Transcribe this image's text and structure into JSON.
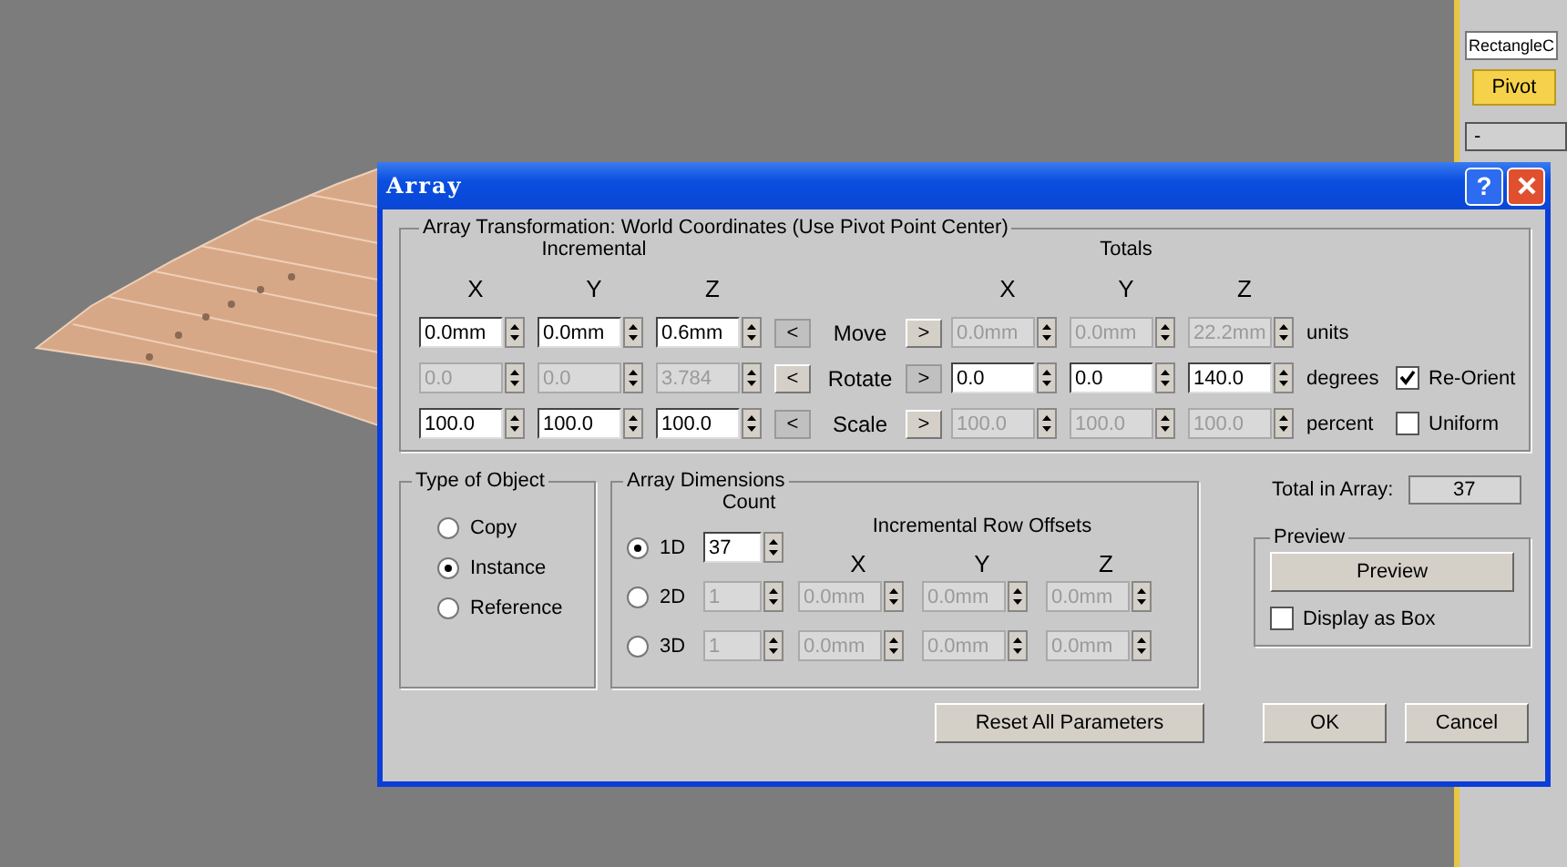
{
  "side_panel": {
    "name_field": "RectangleC",
    "pivot_button": "Pivot",
    "rollout_label": "-"
  },
  "dialog": {
    "title": "Array",
    "help_glyph": "?"
  },
  "transform": {
    "title": "Array Transformation: World Coordinates (Use Pivot Point Center)",
    "incremental_label": "Incremental",
    "totals_label": "Totals",
    "axes_incremental": [
      "X",
      "Y",
      "Z"
    ],
    "axes_totals": [
      "X",
      "Y",
      "Z"
    ],
    "rows": [
      {
        "label": "Move",
        "left_arrow": "<",
        "right_arrow": ">",
        "use_incremental": true,
        "incremental": [
          "0.0mm",
          "0.0mm",
          "0.6mm"
        ],
        "totals": [
          "0.0mm",
          "0.0mm",
          "22.2mm"
        ],
        "unit": "units"
      },
      {
        "label": "Rotate",
        "left_arrow": "<",
        "right_arrow": ">",
        "use_incremental": false,
        "incremental": [
          "0.0",
          "0.0",
          "3.784"
        ],
        "totals": [
          "0.0",
          "0.0",
          "140.0"
        ],
        "unit": "degrees",
        "option": {
          "label": "Re-Orient",
          "checked": true
        }
      },
      {
        "label": "Scale",
        "left_arrow": "<",
        "right_arrow": ">",
        "use_incremental": true,
        "incremental": [
          "100.0",
          "100.0",
          "100.0"
        ],
        "totals": [
          "100.0",
          "100.0",
          "100.0"
        ],
        "unit": "percent",
        "option": {
          "label": "Uniform",
          "checked": false
        }
      }
    ]
  },
  "type_of_object": {
    "title": "Type of Object",
    "options": [
      {
        "label": "Copy",
        "selected": false
      },
      {
        "label": "Instance",
        "selected": true
      },
      {
        "label": "Reference",
        "selected": false
      }
    ]
  },
  "array_dimensions": {
    "title": "Array Dimensions",
    "count_label": "Count",
    "offsets_label": "Incremental Row Offsets",
    "axes": [
      "X",
      "Y",
      "Z"
    ],
    "rows": [
      {
        "label": "1D",
        "selected": true,
        "count": "37"
      },
      {
        "label": "2D",
        "selected": false,
        "count": "1",
        "offsets": [
          "0.0mm",
          "0.0mm",
          "0.0mm"
        ]
      },
      {
        "label": "3D",
        "selected": false,
        "count": "1",
        "offsets": [
          "0.0mm",
          "0.0mm",
          "0.0mm"
        ]
      }
    ]
  },
  "total_in_array": {
    "label": "Total in Array:",
    "value": "37"
  },
  "preview": {
    "title": "Preview",
    "button": "Preview",
    "display_as_box": {
      "label": "Display as Box",
      "checked": false
    }
  },
  "buttons": {
    "reset": "Reset All Parameters",
    "ok": "OK",
    "cancel": "Cancel"
  }
}
